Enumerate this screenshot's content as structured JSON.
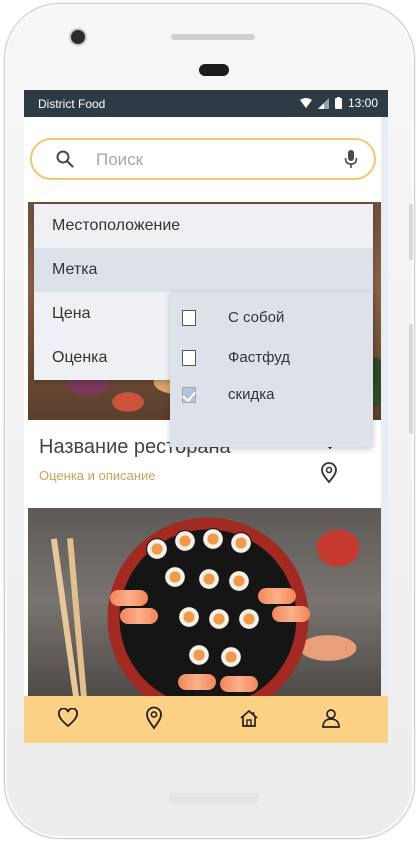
{
  "status_bar": {
    "app_name": "District  Food",
    "time": "13:00"
  },
  "search": {
    "placeholder": "Поиск"
  },
  "filter_menu": {
    "items": [
      "Местоположение",
      "Метка",
      "Цена",
      "Оценка"
    ],
    "submenu": [
      {
        "label": "С собой",
        "checked": false
      },
      {
        "label": "Фастфуд",
        "checked": false
      },
      {
        "label": "скидка",
        "checked": true
      }
    ]
  },
  "restaurant": {
    "name": "Название ресторана",
    "description": "Оценка и описание"
  },
  "bottom_nav": {
    "items": [
      {
        "icon": "heart-icon"
      },
      {
        "icon": "location-pin-icon"
      },
      {
        "icon": "home-icon"
      },
      {
        "icon": "profile-icon"
      }
    ]
  },
  "colors": {
    "accent": "#f1c66f",
    "nav_bg": "#fcd186",
    "status_bar": "#2f3b44",
    "menu_bg": "#eef0f4",
    "menu_selected": "#dde2ea"
  }
}
